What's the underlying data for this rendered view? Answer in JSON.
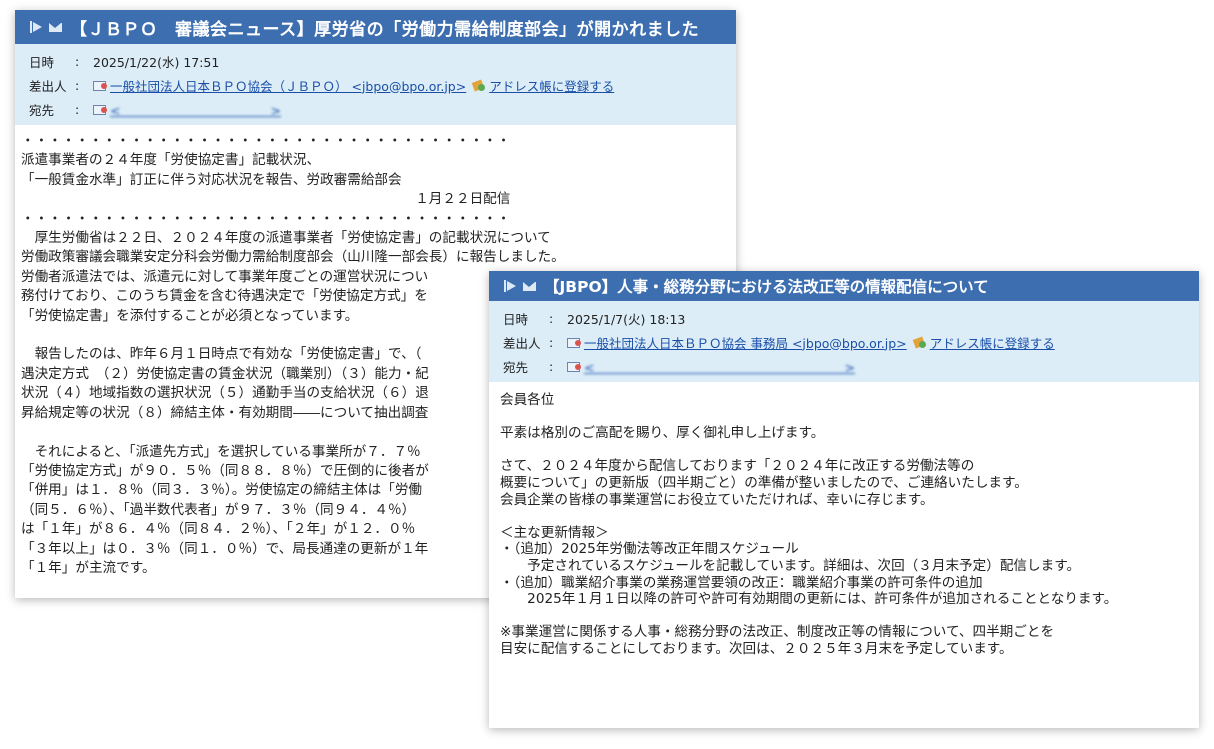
{
  "email1": {
    "subject": "【ＪＢＰＯ　審議会ニュース】厚労省の「労働力需給制度部会」が開かれました",
    "date_label": "日時",
    "date": "2025/1/22(水) 17:51",
    "from_label": "差出人",
    "from": "一般社団法人日本ＢＰＯ協会（ＪＢＰＯ） <jbpo@bpo.or.jp>",
    "addressbook_link": "アドレス帳に登録する",
    "to_label": "宛先",
    "to": "<　　　　　　　　　　　　>",
    "body": "・・・・・・・・・・・・・・・・・・・・・・・・・・・・・・・・・・・・\n派遣事業者の２４年度「労使協定書」記載状況、\n「一般賃金水準」訂正に伴う対応状況を報告、労政審需給部会\n　　　　　　　　　　　　　　　　　　　　　　　　　　　　　１月２２日配信\n・・・・・・・・・・・・・・・・・・・・・・・・・・・・・・・・・・・・\n　厚生労働省は２２日、２０２４年度の派遣事業者「労使協定書」の記載状況について\n労働政策審議会職業安定分科会労働力需給制度部会（山川隆一部会長）に報告しました。\n労働者派遣法では、派遣元に対して事業年度ごとの運営状況につい\n務付けており、このうち賃金を含む待遇決定で「労使協定方式」を\n「労使協定書」を添付することが必須となっています。\n\n　報告したのは、昨年６月１日時点で有効な「労使協定書」で、（\n遇決定方式　（２）労使協定書の賃金状況（職業別）（３）能力・紀\n状況（４）地域指数の選択状況（５）通勤手当の支給状況（６）退\n昇給規定等の状況（８）締結主体・有効期間――について抽出調査\n\n　それによると、「派遣先方式」を選択している事業所が７．７％\n「労使協定方式」が９０．５％（同８８．８％）で圧倒的に後者が\n「併用」は１．８％（同３．３％）。労使協定の締結主体は「労働\n（同５．６％）、「過半数代表者」が９７．３％（同９４．４％）\nは「１年」が８６．４％（同８４．２％）、「２年」が１２．０％\n「３年以上」は０．３％（同１．０％）で、局長通達の更新が１年\n「１年」が主流です。"
  },
  "email2": {
    "subject": "【JBPO】人事・総務分野における法改正等の情報配信について",
    "date_label": "日時",
    "date": "2025/1/7(火) 18:13",
    "from_label": "差出人",
    "from": "一般社団法人日本ＢＰＯ協会 事務局 <jbpo@bpo.or.jp>",
    "addressbook_link": "アドレス帳に登録する",
    "to_label": "宛先",
    "to": "<　　　　　　　　　　　　　　　　　　　　>",
    "body": "会員各位\n\n平素は格別のご高配を賜り、厚く御礼申し上げます。\n\nさて、２０２４年度から配信しております「２０２４年に改正する労働法等の\n概要について」の更新版（四半期ごと）の準備が整いましたので、ご連絡いたします。\n会員企業の皆様の事業運営にお役立ていただければ、幸いに存じます。\n\n＜主な更新情報＞\n・（追加）2025年労働法等改正年間スケジュール\n　　予定されているスケジュールを記載しています。詳細は、次回（３月末予定）配信します。\n・（追加）職業紹介事業の業務運営要領の改正：職業紹介事業の許可条件の追加\n　　2025年１月１日以降の許可や許可有効期間の更新には、許可条件が追加されることとなります。\n\n※事業運営に関係する人事・総務分野の法改正、制度改正等の情報について、四半期ごとを\n目安に配信することにしております。次回は、２０２５年３月末を予定しています。"
  },
  "colors": {
    "title_bar": "#3c6eb0",
    "header_bg": "#dcedf8",
    "link": "#1a4fa8"
  },
  "icons": [
    "flag-icon",
    "envelope-icon",
    "contact-icon",
    "addressbook-icon"
  ]
}
